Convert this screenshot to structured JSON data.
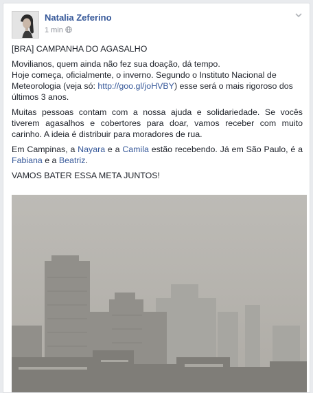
{
  "post": {
    "author": "Natalia Zeferino",
    "timestamp": "1 min",
    "title": "[BRA] CAMPANHA DO AGASALHO",
    "p1": {
      "line1": "Movilianos, quem ainda não fez sua doação, dá tempo.",
      "line2_before": "Hoje começa, oficialmente, o inverno. Segundo o Instituto Nacional de Meteorologia (veja só: ",
      "link": "http://goo.gl/joHVBY",
      "line2_after": ") esse será o mais rigoroso dos últimos 3 anos."
    },
    "p2": "Muitas pessoas contam com a nossa ajuda e solidariedade. Se vocês tiverem agasalhos e cobertores para doar, vamos receber com muito carinho. A ideia é distribuir para moradores de rua.",
    "p3": {
      "t1": "Em Campinas, a ",
      "name1": "Nayara",
      "t2": " e a ",
      "name2": "Camila",
      "t3": " estão recebendo. Já em São Paulo, é a ",
      "name3": "Fabiana",
      "t4": " e a ",
      "name4": "Beatriz",
      "t5": "."
    },
    "p4": "VAMOS BATER ESSA META JUNTOS!"
  },
  "icons": {
    "privacy": "globe-icon",
    "menu": "chevron-down-icon"
  },
  "colors": {
    "link": "#365899",
    "text": "#1d2129",
    "meta": "#90949c",
    "background": "#e9ebee"
  }
}
